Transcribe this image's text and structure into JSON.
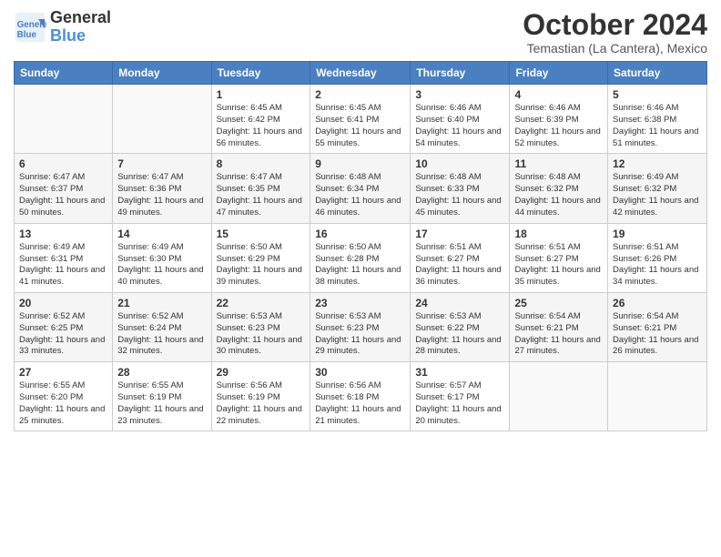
{
  "logo": {
    "line1": "General",
    "line2": "Blue"
  },
  "title": "October 2024",
  "location": "Temastian (La Cantera), Mexico",
  "weekdays": [
    "Sunday",
    "Monday",
    "Tuesday",
    "Wednesday",
    "Thursday",
    "Friday",
    "Saturday"
  ],
  "rows": [
    [
      {
        "day": "",
        "info": ""
      },
      {
        "day": "",
        "info": ""
      },
      {
        "day": "1",
        "info": "Sunrise: 6:45 AM\nSunset: 6:42 PM\nDaylight: 11 hours and 56 minutes."
      },
      {
        "day": "2",
        "info": "Sunrise: 6:45 AM\nSunset: 6:41 PM\nDaylight: 11 hours and 55 minutes."
      },
      {
        "day": "3",
        "info": "Sunrise: 6:46 AM\nSunset: 6:40 PM\nDaylight: 11 hours and 54 minutes."
      },
      {
        "day": "4",
        "info": "Sunrise: 6:46 AM\nSunset: 6:39 PM\nDaylight: 11 hours and 52 minutes."
      },
      {
        "day": "5",
        "info": "Sunrise: 6:46 AM\nSunset: 6:38 PM\nDaylight: 11 hours and 51 minutes."
      }
    ],
    [
      {
        "day": "6",
        "info": "Sunrise: 6:47 AM\nSunset: 6:37 PM\nDaylight: 11 hours and 50 minutes."
      },
      {
        "day": "7",
        "info": "Sunrise: 6:47 AM\nSunset: 6:36 PM\nDaylight: 11 hours and 49 minutes."
      },
      {
        "day": "8",
        "info": "Sunrise: 6:47 AM\nSunset: 6:35 PM\nDaylight: 11 hours and 47 minutes."
      },
      {
        "day": "9",
        "info": "Sunrise: 6:48 AM\nSunset: 6:34 PM\nDaylight: 11 hours and 46 minutes."
      },
      {
        "day": "10",
        "info": "Sunrise: 6:48 AM\nSunset: 6:33 PM\nDaylight: 11 hours and 45 minutes."
      },
      {
        "day": "11",
        "info": "Sunrise: 6:48 AM\nSunset: 6:32 PM\nDaylight: 11 hours and 44 minutes."
      },
      {
        "day": "12",
        "info": "Sunrise: 6:49 AM\nSunset: 6:32 PM\nDaylight: 11 hours and 42 minutes."
      }
    ],
    [
      {
        "day": "13",
        "info": "Sunrise: 6:49 AM\nSunset: 6:31 PM\nDaylight: 11 hours and 41 minutes."
      },
      {
        "day": "14",
        "info": "Sunrise: 6:49 AM\nSunset: 6:30 PM\nDaylight: 11 hours and 40 minutes."
      },
      {
        "day": "15",
        "info": "Sunrise: 6:50 AM\nSunset: 6:29 PM\nDaylight: 11 hours and 39 minutes."
      },
      {
        "day": "16",
        "info": "Sunrise: 6:50 AM\nSunset: 6:28 PM\nDaylight: 11 hours and 38 minutes."
      },
      {
        "day": "17",
        "info": "Sunrise: 6:51 AM\nSunset: 6:27 PM\nDaylight: 11 hours and 36 minutes."
      },
      {
        "day": "18",
        "info": "Sunrise: 6:51 AM\nSunset: 6:27 PM\nDaylight: 11 hours and 35 minutes."
      },
      {
        "day": "19",
        "info": "Sunrise: 6:51 AM\nSunset: 6:26 PM\nDaylight: 11 hours and 34 minutes."
      }
    ],
    [
      {
        "day": "20",
        "info": "Sunrise: 6:52 AM\nSunset: 6:25 PM\nDaylight: 11 hours and 33 minutes."
      },
      {
        "day": "21",
        "info": "Sunrise: 6:52 AM\nSunset: 6:24 PM\nDaylight: 11 hours and 32 minutes."
      },
      {
        "day": "22",
        "info": "Sunrise: 6:53 AM\nSunset: 6:23 PM\nDaylight: 11 hours and 30 minutes."
      },
      {
        "day": "23",
        "info": "Sunrise: 6:53 AM\nSunset: 6:23 PM\nDaylight: 11 hours and 29 minutes."
      },
      {
        "day": "24",
        "info": "Sunrise: 6:53 AM\nSunset: 6:22 PM\nDaylight: 11 hours and 28 minutes."
      },
      {
        "day": "25",
        "info": "Sunrise: 6:54 AM\nSunset: 6:21 PM\nDaylight: 11 hours and 27 minutes."
      },
      {
        "day": "26",
        "info": "Sunrise: 6:54 AM\nSunset: 6:21 PM\nDaylight: 11 hours and 26 minutes."
      }
    ],
    [
      {
        "day": "27",
        "info": "Sunrise: 6:55 AM\nSunset: 6:20 PM\nDaylight: 11 hours and 25 minutes."
      },
      {
        "day": "28",
        "info": "Sunrise: 6:55 AM\nSunset: 6:19 PM\nDaylight: 11 hours and 23 minutes."
      },
      {
        "day": "29",
        "info": "Sunrise: 6:56 AM\nSunset: 6:19 PM\nDaylight: 11 hours and 22 minutes."
      },
      {
        "day": "30",
        "info": "Sunrise: 6:56 AM\nSunset: 6:18 PM\nDaylight: 11 hours and 21 minutes."
      },
      {
        "day": "31",
        "info": "Sunrise: 6:57 AM\nSunset: 6:17 PM\nDaylight: 11 hours and 20 minutes."
      },
      {
        "day": "",
        "info": ""
      },
      {
        "day": "",
        "info": ""
      }
    ]
  ]
}
